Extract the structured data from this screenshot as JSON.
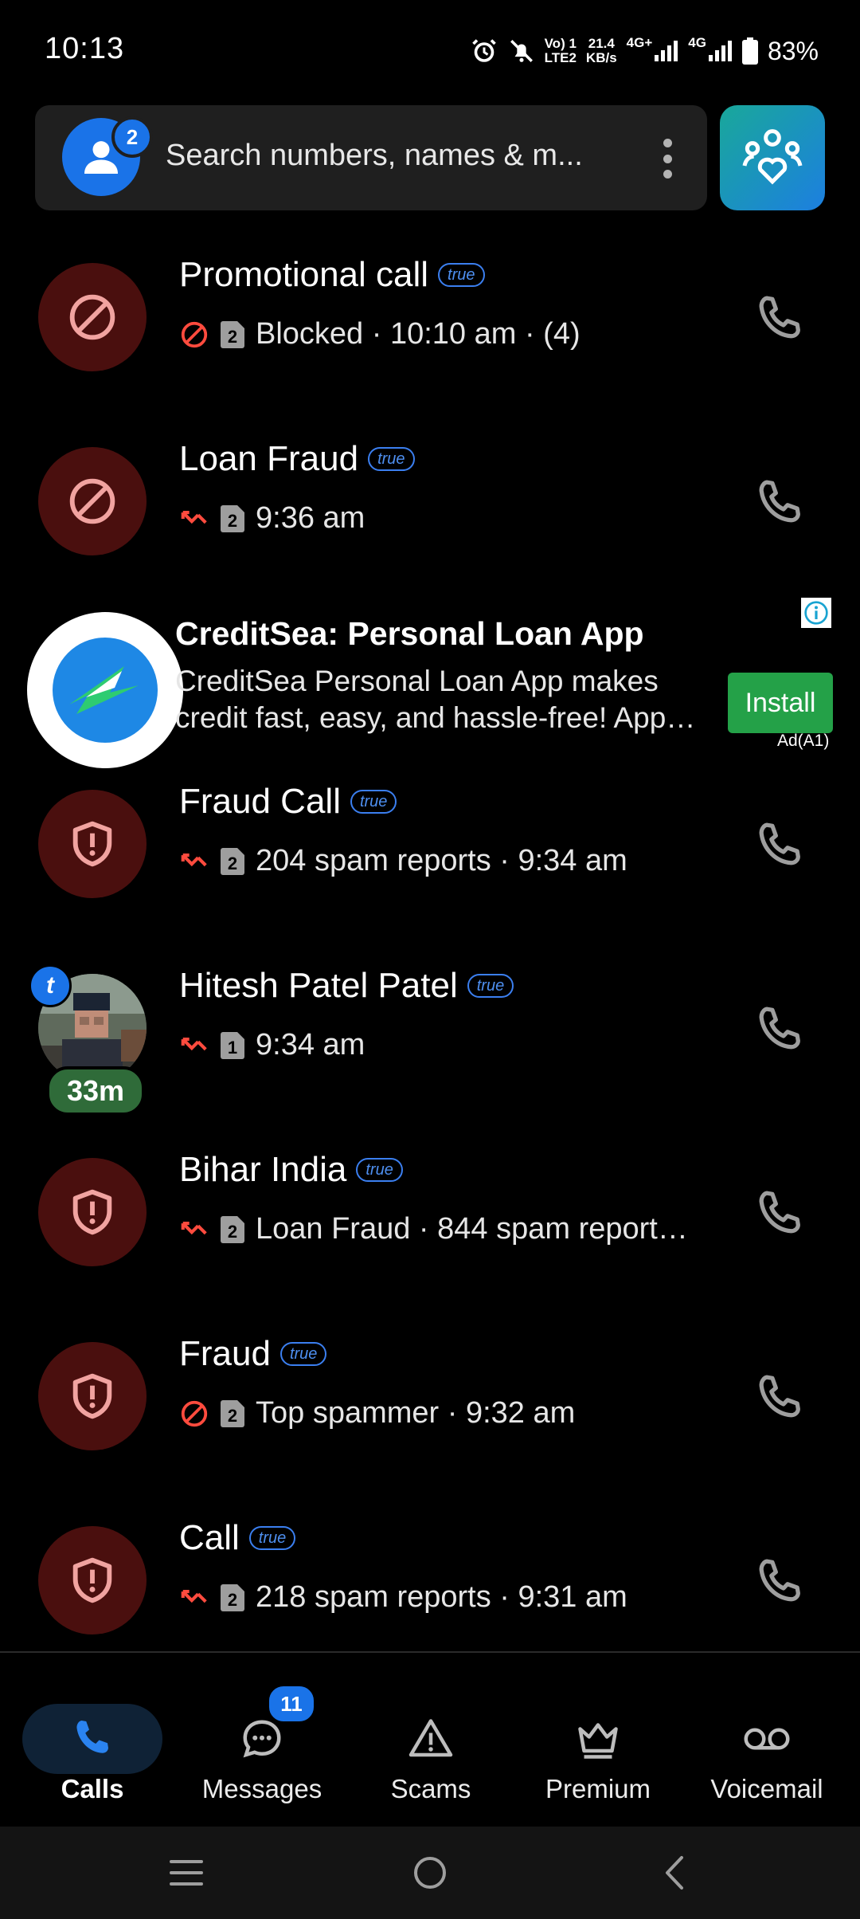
{
  "status_bar": {
    "time": "10:13",
    "volte_line1": "Vo) 1",
    "volte_line2": "LTE2",
    "speed_value": "21.4",
    "speed_unit": "KB/s",
    "net1": "4G+",
    "net2": "4G",
    "battery": "83%"
  },
  "search": {
    "placeholder": "Search numbers, names & m...",
    "avatar_badge": "2"
  },
  "calls": [
    {
      "name": "Promotional call",
      "badge": "true",
      "status_icon": "blocked-icon",
      "sim": "2",
      "detail": "Blocked · 10:10 am · (4)",
      "avatar": "block-icon"
    },
    {
      "name": "Loan Fraud",
      "badge": "true",
      "status_icon": "missed-call-icon",
      "sim": "2",
      "detail": "9:36 am",
      "avatar": "block-icon"
    },
    {
      "name": "Fraud Call",
      "badge": "true",
      "status_icon": "missed-call-icon",
      "sim": "2",
      "detail": "204 spam reports · 9:34 am",
      "avatar": "shield-alert-icon"
    },
    {
      "name": "Hitesh Patel Patel",
      "badge": "true",
      "status_icon": "missed-call-icon",
      "sim": "1",
      "detail": "9:34 am",
      "avatar": "photo",
      "time_badge": "33m",
      "photo_badge": "t"
    },
    {
      "name": "Bihar India",
      "badge": "true",
      "status_icon": "missed-call-icon",
      "sim": "2",
      "detail": "Loan Fraud · 844 spam reports…",
      "avatar": "shield-alert-icon"
    },
    {
      "name": "Fraud",
      "badge": "true",
      "status_icon": "blocked-icon",
      "sim": "2",
      "detail": "Top spammer · 9:32 am",
      "avatar": "shield-alert-icon"
    },
    {
      "name": "Call",
      "badge": "true",
      "status_icon": "missed-call-icon",
      "sim": "2",
      "detail": "218 spam reports · 9:31 am",
      "avatar": "shield-alert-icon"
    }
  ],
  "ad": {
    "title": "CreditSea: Personal Loan App",
    "description": "CreditSea Personal Loan App makes credit fast, easy, and hassle-free! App…",
    "install_label": "Install",
    "ad_label": "Ad(A1)"
  },
  "nav": {
    "calls": "Calls",
    "messages": "Messages",
    "messages_badge": "11",
    "scams": "Scams",
    "premium": "Premium",
    "voicemail": "Voicemail"
  },
  "colors": {
    "spam_avatar_bg": "#4a0f0e",
    "accent_blue": "#1a73e8",
    "missed_red": "#ff4b3e",
    "install_green": "#24a148"
  }
}
